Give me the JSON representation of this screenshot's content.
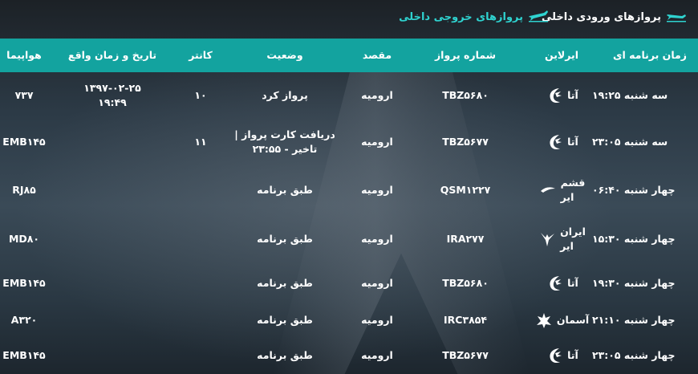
{
  "tabs": {
    "arrivals": "پروازهای ورودی داخلی",
    "departures": "پروازهای خروجی داخلی"
  },
  "columns": {
    "scheduled": "زمان برنامه ای",
    "airline": "ایرلاین",
    "flight": "شماره پرواز",
    "destination": "مقصد",
    "status": "وضعیت",
    "counter": "کانتر",
    "actual": "تاریخ و زمان واقع",
    "aircraft": "هواپیما"
  },
  "rows": [
    {
      "scheduled": "سه شنبه ۱۹:۲۵",
      "airline": "آتا",
      "airline_line2": "",
      "logo": "ata-logo-icon",
      "flight": "TBZ۵۶۸۰",
      "destination": "ارومیه",
      "status": "پرواز کرد",
      "status_line2": "",
      "counter": "۱۰",
      "actual": "۱۳۹۷-۰۲-۲۵",
      "actual_line2": "۱۹:۴۹",
      "aircraft": "۷۳۷"
    },
    {
      "scheduled": "سه شنبه ۲۳:۰۵",
      "airline": "آتا",
      "airline_line2": "",
      "logo": "ata-logo-icon",
      "flight": "TBZ۵۶۷۷",
      "destination": "ارومیه",
      "status": "دریافت کارت پرواز |",
      "status_line2": "تاخیر - ۲۳:۵۵",
      "counter": "۱۱",
      "actual": "",
      "actual_line2": "",
      "aircraft": "EMB۱۴۵"
    },
    {
      "scheduled": "چهار شنبه ۰۶:۴۰",
      "airline": "قشم",
      "airline_line2": "ایر",
      "logo": "qeshm-air-logo-icon",
      "flight": "QSM۱۲۲۷",
      "destination": "ارومیه",
      "status": "طبق برنامه",
      "status_line2": "",
      "counter": "",
      "actual": "",
      "actual_line2": "",
      "aircraft": "RJ۸۵"
    },
    {
      "scheduled": "چهار شنبه ۱۵:۳۰",
      "airline": "ایران",
      "airline_line2": "ایر",
      "logo": "iran-air-logo-icon",
      "flight": "IRA۲۷۷",
      "destination": "ارومیه",
      "status": "طبق برنامه",
      "status_line2": "",
      "counter": "",
      "actual": "",
      "actual_line2": "",
      "aircraft": "MD۸۰"
    },
    {
      "scheduled": "چهار شنبه ۱۹:۳۰",
      "airline": "آتا",
      "airline_line2": "",
      "logo": "ata-logo-icon",
      "flight": "TBZ۵۶۸۰",
      "destination": "ارومیه",
      "status": "طبق برنامه",
      "status_line2": "",
      "counter": "",
      "actual": "",
      "actual_line2": "",
      "aircraft": "EMB۱۴۵"
    },
    {
      "scheduled": "چهار شنبه ۲۱:۱۰",
      "airline": "آسمان",
      "airline_line2": "",
      "logo": "aseman-logo-icon",
      "flight": "IRC۳۸۵۴",
      "destination": "ارومیه",
      "status": "طبق برنامه",
      "status_line2": "",
      "counter": "",
      "actual": "",
      "actual_line2": "",
      "aircraft": "A۳۲۰"
    },
    {
      "scheduled": "چهار شنبه ۲۳:۰۵",
      "airline": "آتا",
      "airline_line2": "",
      "logo": "ata-logo-icon",
      "flight": "TBZ۵۶۷۷",
      "destination": "ارومیه",
      "status": "طبق برنامه",
      "status_line2": "",
      "counter": "",
      "actual": "",
      "actual_line2": "",
      "aircraft": "EMB۱۴۵"
    }
  ],
  "colors": {
    "header": "#13a39f",
    "departures_tab": "#2fd3d0"
  }
}
